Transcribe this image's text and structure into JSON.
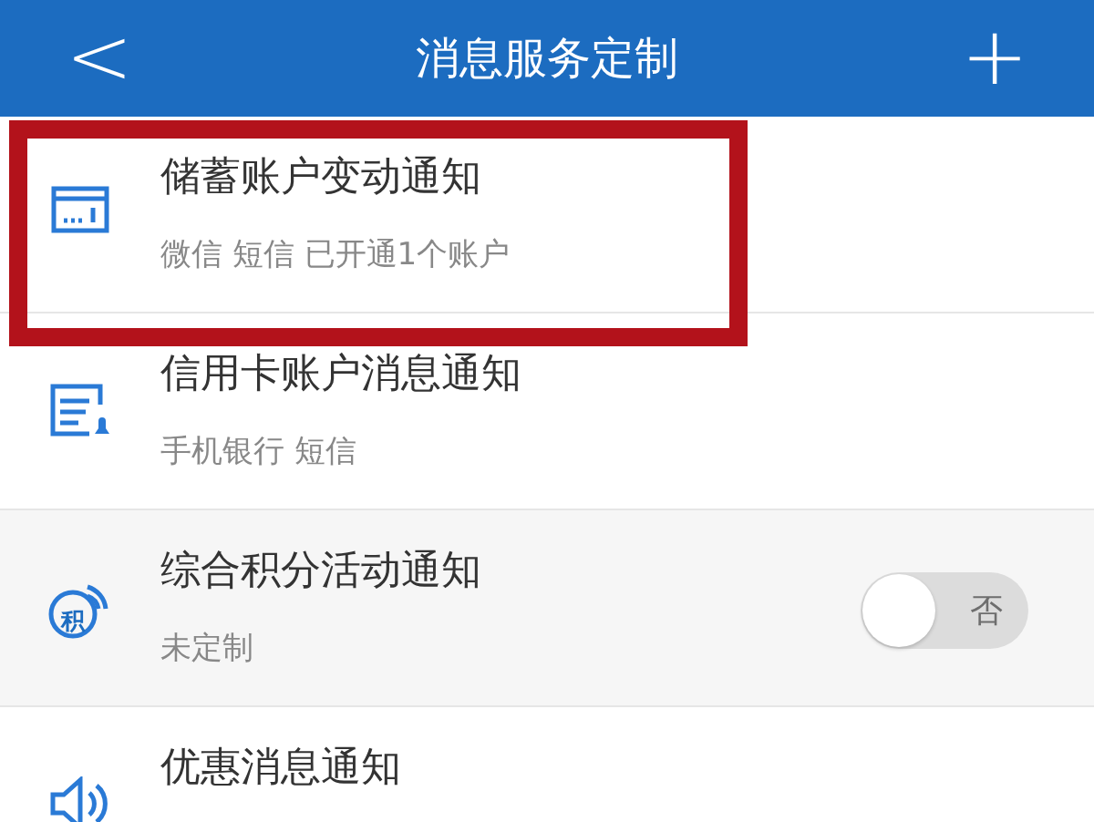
{
  "header": {
    "back": "<",
    "title": "消息服务定制",
    "add": "+"
  },
  "items": [
    {
      "kind": "card",
      "title": "储蓄账户变动通知",
      "subtitle": "微信 短信 已开通1个账户",
      "highlighted": true,
      "shaded": false
    },
    {
      "kind": "bill",
      "title": "信用卡账户消息通知",
      "subtitle": "手机银行 短信",
      "highlighted": false,
      "shaded": false
    },
    {
      "kind": "points",
      "icon_text": "积",
      "title": "综合积分活动通知",
      "subtitle": "未定制",
      "highlighted": false,
      "shaded": true,
      "toggle": {
        "on": false,
        "label": "否"
      }
    },
    {
      "kind": "speaker",
      "title": "优惠消息通知",
      "highlighted": false,
      "shaded": false
    }
  ]
}
